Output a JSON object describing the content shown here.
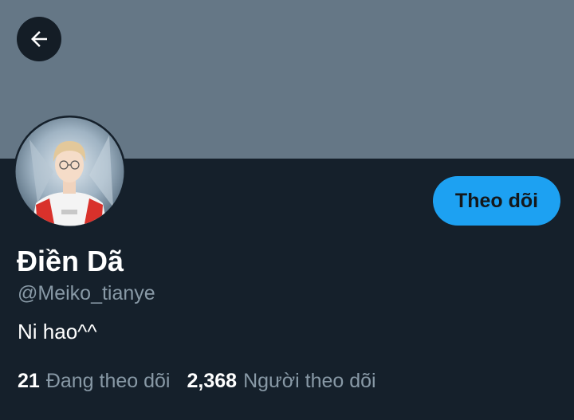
{
  "profile": {
    "display_name": "Điền Dã",
    "handle": "@Meiko_tianye",
    "bio": "Ni hao^^",
    "follow_label": "Theo dõi"
  },
  "stats": {
    "following_count": "21",
    "following_label": "Đang theo dõi",
    "followers_count": "2,368",
    "followers_label": "Người theo dõi"
  },
  "colors": {
    "background": "#15202b",
    "banner": "#657786",
    "accent": "#1da1f2",
    "secondary_text": "#8899a6"
  },
  "icons": {
    "back": "arrow-left-icon",
    "avatar": "profile-photo"
  }
}
